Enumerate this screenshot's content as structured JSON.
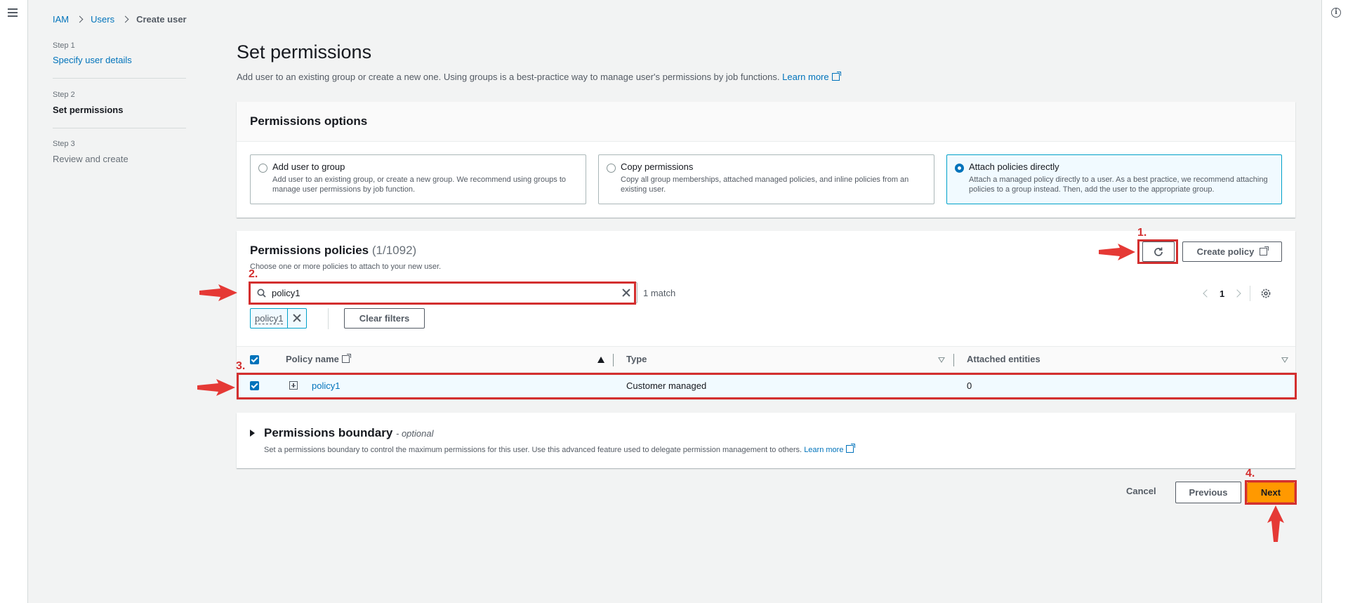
{
  "breadcrumbs": [
    "IAM",
    "Users",
    "Create user"
  ],
  "steps": [
    {
      "label": "Step 1",
      "title": "Specify user details"
    },
    {
      "label": "Step 2",
      "title": "Set permissions"
    },
    {
      "label": "Step 3",
      "title": "Review and create"
    }
  ],
  "page": {
    "title": "Set permissions",
    "description": "Add user to an existing group or create a new one. Using groups is a best-practice way to manage user's permissions by job functions.",
    "learn_more": "Learn more"
  },
  "permissions_options": {
    "title": "Permissions options",
    "options": [
      {
        "title": "Add user to group",
        "desc": "Add user to an existing group, or create a new group. We recommend using groups to manage user permissions by job function.",
        "selected": false
      },
      {
        "title": "Copy permissions",
        "desc": "Copy all group memberships, attached managed policies, and inline policies from an existing user.",
        "selected": false
      },
      {
        "title": "Attach policies directly",
        "desc": "Attach a managed policy directly to a user. As a best practice, we recommend attaching policies to a group instead. Then, add the user to the appropriate group.",
        "selected": true
      }
    ]
  },
  "policies": {
    "title": "Permissions policies",
    "count": "(1/1092)",
    "description": "Choose one or more policies to attach to your new user.",
    "create_policy": "Create policy",
    "search_value": "policy1",
    "match_text": "1 match",
    "page_number": "1",
    "filter_token": "policy1",
    "clear_filters": "Clear filters",
    "columns": [
      "Policy name",
      "Type",
      "Attached entities"
    ],
    "rows": [
      {
        "name": "policy1",
        "type": "Customer managed",
        "attached": "0",
        "checked": true
      }
    ]
  },
  "boundary": {
    "title": "Permissions boundary",
    "optional": "- optional",
    "description": "Set a permissions boundary to control the maximum permissions for this user. Use this advanced feature used to delegate permission management to others.",
    "learn_more": "Learn more"
  },
  "footer": {
    "cancel": "Cancel",
    "previous": "Previous",
    "next": "Next"
  },
  "annotations": [
    "1.",
    "2.",
    "3.",
    "4."
  ],
  "colors": {
    "accent": "#0073bb",
    "primary_button": "#ff9900",
    "annotation": "#d32f2f",
    "selected_bg": "#f1faff"
  },
  "icons": [
    "menu-icon",
    "info-icon",
    "chevron-right-icon",
    "external-link-icon",
    "refresh-icon",
    "search-icon",
    "close-icon",
    "chevron-left-icon",
    "settings-gear-icon",
    "sort-ascending-icon",
    "sort-descending-icon",
    "expand-plus-icon",
    "caret-right-icon",
    "arrow-icon"
  ]
}
